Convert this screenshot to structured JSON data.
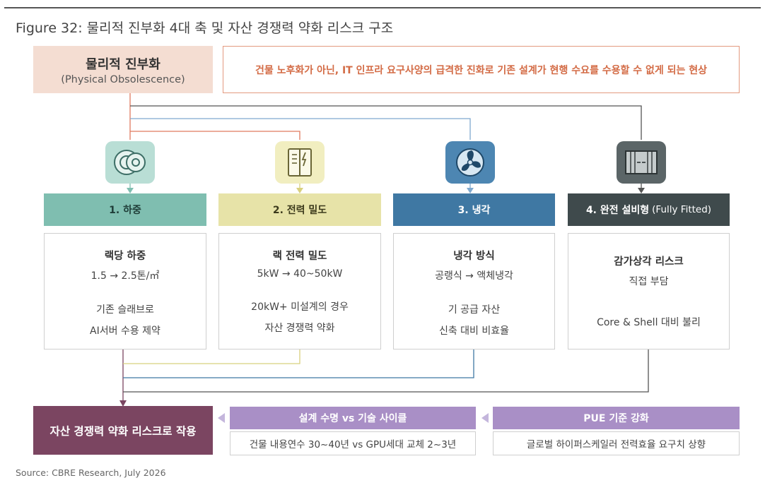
{
  "figure_title": "Figure 32: 물리적 진부화 4대 축 및 자산 경쟁력 약화 리스크 구조",
  "physical": {
    "title": "물리적 진부화",
    "subtitle": "(Physical Obsolescence)"
  },
  "description": "건물 노후화가 아닌, IT 인프라 요구사양의 급격한 진화로 기존 설계가 현행 수요를 수용할 수 없게 되는 현상",
  "categories": [
    {
      "header": "1. 하중",
      "header_suffix": "",
      "icon": "cable-reel-icon",
      "title": "랙당 하중",
      "line1": "1.5 → 2.5톤/㎡",
      "line2": "기존 슬래브로",
      "line3": "AI서버 수용 제약"
    },
    {
      "header": "2. 전력 밀도",
      "header_suffix": "",
      "icon": "electrical-panel-icon",
      "title": "랙 전력 밀도",
      "line1": "5kW → 40~50kW",
      "line2": "20kW+ 미설계의 경우",
      "line3": "자산 경쟁력 약화"
    },
    {
      "header": "3. 냉각",
      "header_suffix": "",
      "icon": "fan-icon",
      "title": "냉각 방식",
      "line1": "공랭식 → 액체냉각",
      "line2": "기 공급 자산",
      "line3": "신축 대비 비효율"
    },
    {
      "header": "4. 완전 설비형",
      "header_suffix": "(Fully Fitted)",
      "icon": "server-rack-icon",
      "title": "감가상각 리스크",
      "line1": "직접 부담",
      "line2": "",
      "line3": "Core & Shell 대비 불리"
    }
  ],
  "result": "자산 경쟁력 약화 리스크로 작용",
  "factor1": {
    "header": "설계 수명 vs 기술 사이클",
    "body": "건물 내용연수 30~40년 vs GPU세대 교체 2~3년"
  },
  "factor2": {
    "header": "PUE 기준 강화",
    "body": "글로벌 하이퍼스케일러 전력효율 요구치 상향"
  },
  "source": "Source: CBRE Research, July 2026",
  "colors": {
    "physical_bg": "#f4ddd2",
    "desc_border": "#e39a80",
    "desc_text": "#d36b45",
    "cat1": "#7fbeb0",
    "cat2": "#e7e3a8",
    "cat3": "#3f78a3",
    "cat4": "#3f4a4c",
    "result": "#7b4561",
    "factor_header": "#a98fc6"
  }
}
